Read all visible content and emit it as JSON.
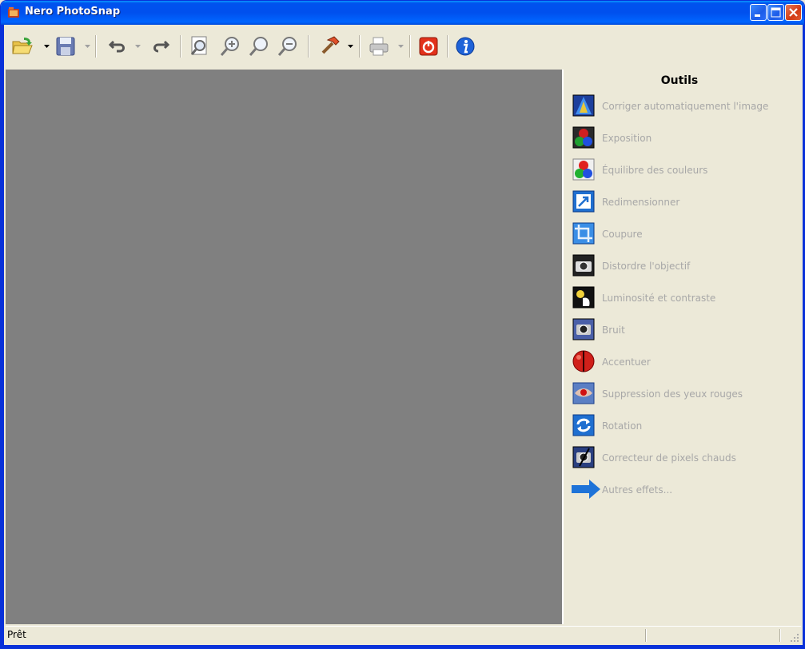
{
  "window": {
    "title": "Nero PhotoSnap"
  },
  "toolbar": {
    "buttons": [
      {
        "icon": "open-folder-icon"
      },
      {
        "icon": "save-icon"
      },
      {
        "icon": "undo-icon"
      },
      {
        "icon": "redo-icon"
      },
      {
        "icon": "zoom-fit-icon"
      },
      {
        "icon": "zoom-in-icon"
      },
      {
        "icon": "zoom-actual-icon"
      },
      {
        "icon": "zoom-out-icon"
      },
      {
        "icon": "tools-hammer-icon"
      },
      {
        "icon": "print-icon"
      },
      {
        "icon": "power-exit-icon"
      },
      {
        "icon": "info-icon"
      }
    ]
  },
  "panel": {
    "title": "Outils",
    "tools": [
      {
        "label": "Corriger automatiquement l'image",
        "icon": "auto-correct-icon"
      },
      {
        "label": "Exposition",
        "icon": "exposure-icon"
      },
      {
        "label": "Équilibre des couleurs",
        "icon": "color-balance-icon"
      },
      {
        "label": "Redimensionner",
        "icon": "resize-icon"
      },
      {
        "label": "Coupure",
        "icon": "crop-icon"
      },
      {
        "label": "Distordre l'objectif",
        "icon": "lens-distort-icon"
      },
      {
        "label": "Luminosité et contraste",
        "icon": "brightness-contrast-icon"
      },
      {
        "label": "Bruit",
        "icon": "noise-icon"
      },
      {
        "label": "Accentuer",
        "icon": "sharpen-icon"
      },
      {
        "label": "Suppression des yeux rouges",
        "icon": "red-eye-icon"
      },
      {
        "label": "Rotation",
        "icon": "rotate-icon"
      },
      {
        "label": "Correcteur de pixels chauds",
        "icon": "hot-pixel-icon"
      },
      {
        "label": "Autres effets...",
        "icon": "more-effects-arrow-icon"
      }
    ]
  },
  "status": {
    "text": "Prêt"
  },
  "colors": {
    "titlebar": "#0054e3",
    "canvas": "#808080",
    "panel": "#ece9d8",
    "disabled_text": "#a7a7a7"
  }
}
